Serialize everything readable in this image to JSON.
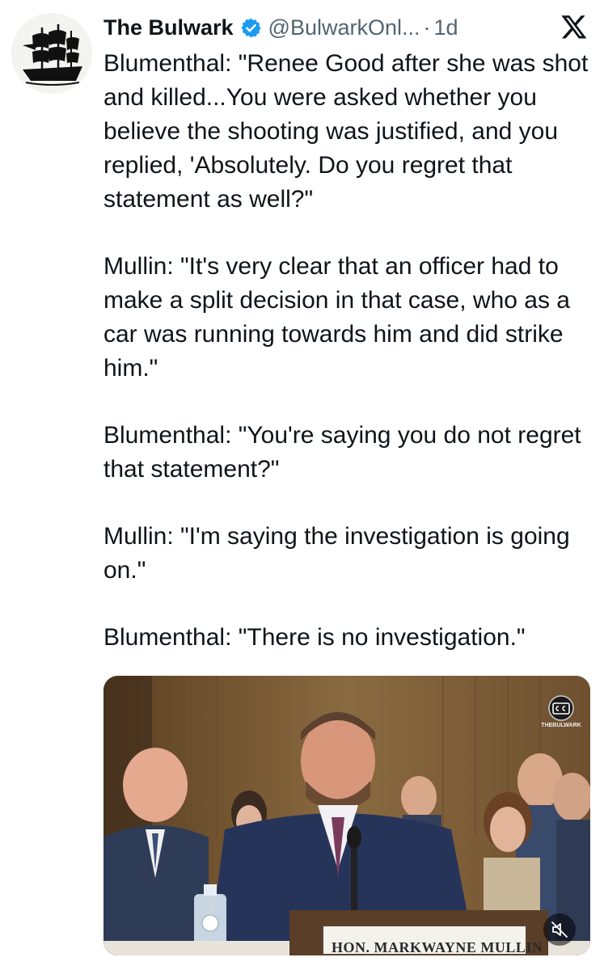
{
  "tweet": {
    "author_name": "The Bulwark",
    "handle": "@BulwarkOnl...",
    "separator": "·",
    "time": "1d",
    "paragraphs": [
      "Blumenthal: \"Renee Good after she was shot and killed...You were asked whether you believe the shooting was justified, and you replied, 'Absolutely. Do you regret that statement as well?\"",
      "Mullin: \"It's very clear that an officer had to make a split decision in that case, who as a car was running towards him and did strike him.\"",
      "Blumenthal: \"You're saying you do not regret that statement?\"",
      "Mullin: \"I'm saying the investigation is going on.\"",
      "Blumenthal: \"There is no investigation.\""
    ]
  },
  "media": {
    "watermark": "THEBULWARK",
    "nameplate": "HON. MARKWAYNE MULLIN"
  },
  "icons": {
    "avatar": "pirate-ship-logo",
    "verified": "verified-badge-icon",
    "platform": "x-logo-icon",
    "captions": "closed-captions-icon",
    "mute": "speaker-muted-icon"
  },
  "colors": {
    "text": "#0f1419",
    "secondary": "#536471",
    "verified": "#1d9bf0"
  }
}
